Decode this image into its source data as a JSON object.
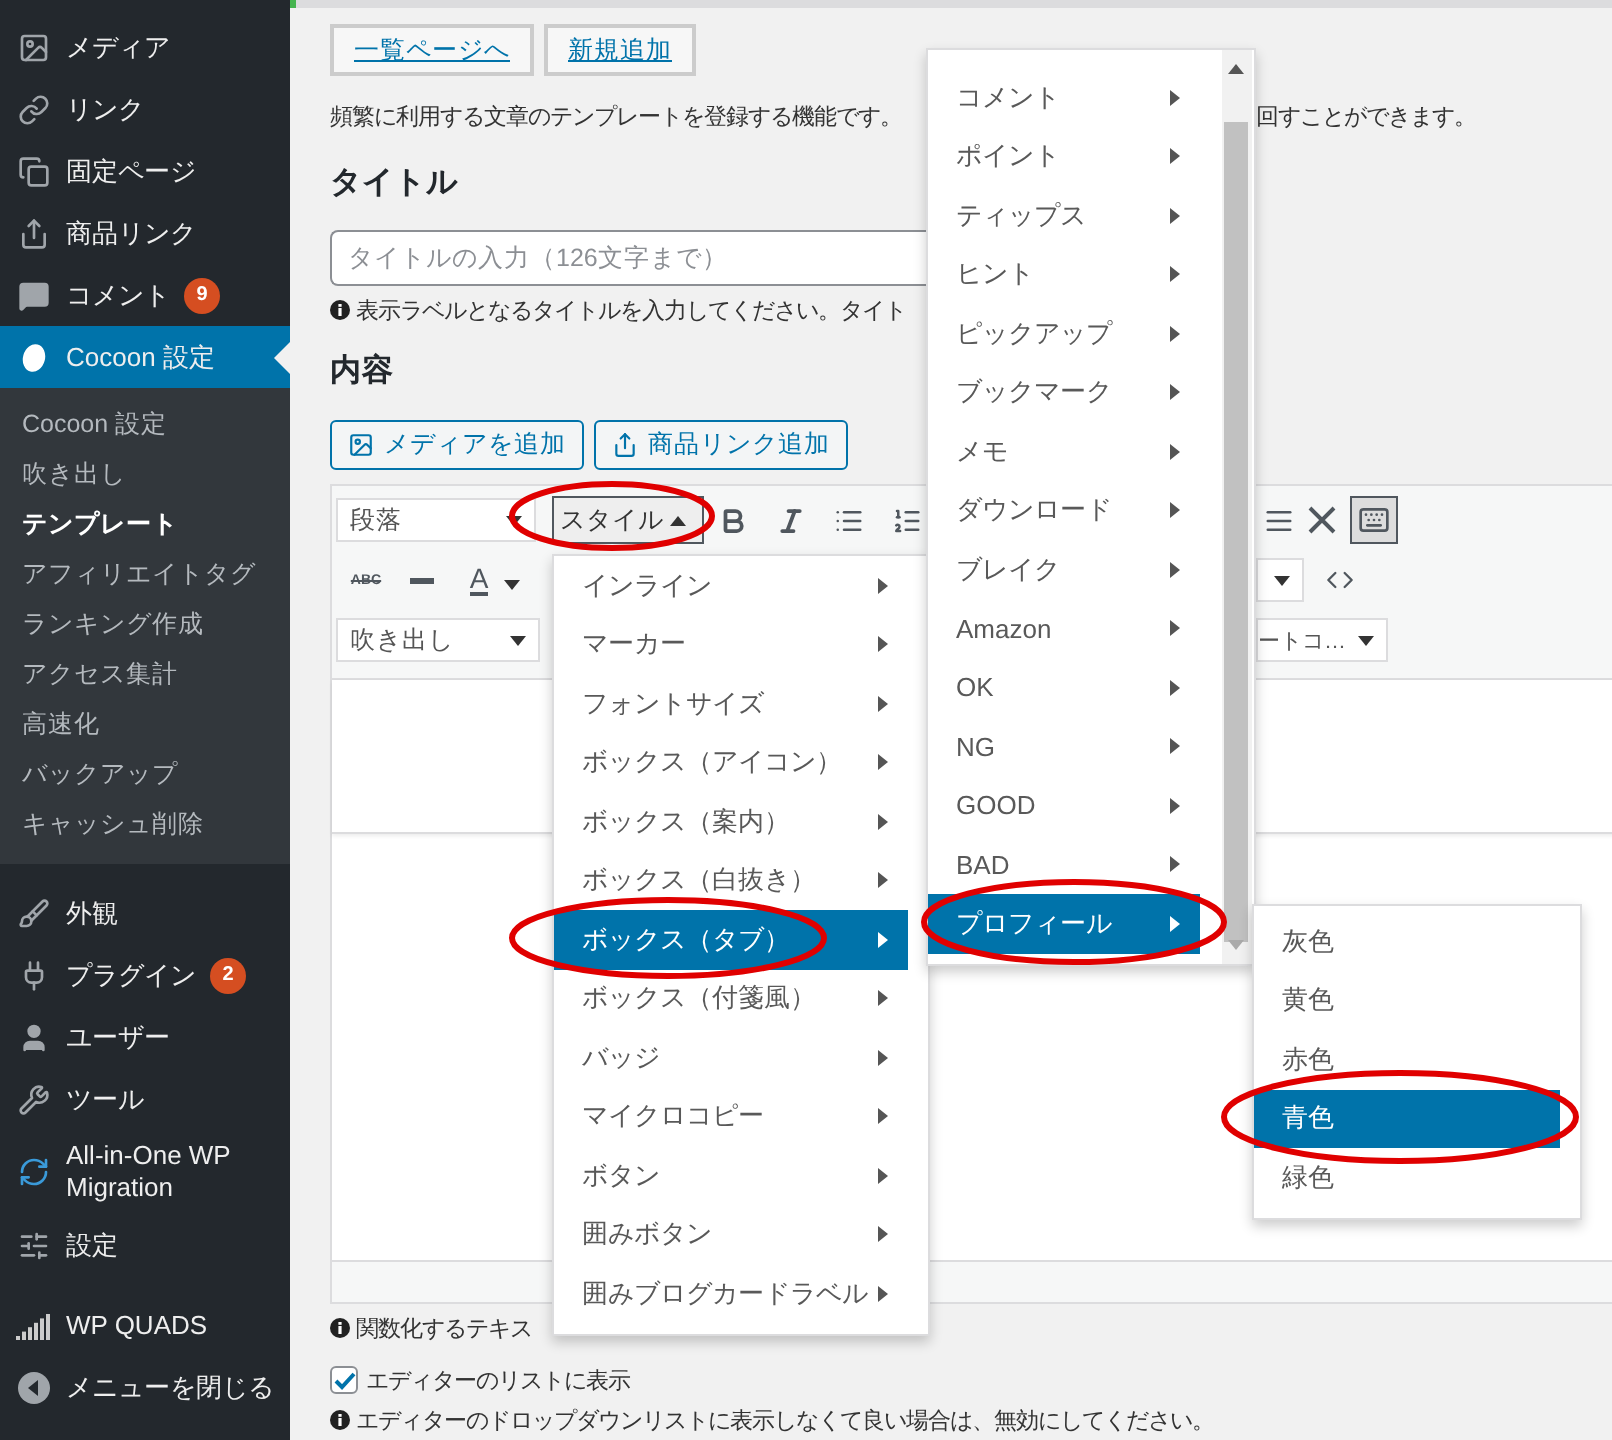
{
  "sidebar": {
    "groups": [
      {
        "items": [
          {
            "label": "メディア",
            "selected": false
          },
          {
            "label": "リンク",
            "selected": false
          },
          {
            "label": "固定ページ",
            "selected": false
          },
          {
            "label": "商品リンク",
            "selected": false
          },
          {
            "label": "コメント",
            "badge": "9",
            "selected": false
          },
          {
            "label": "Cocoon 設定",
            "selected": true,
            "children": [
              {
                "label": "Cocoon 設定",
                "selected": false
              },
              {
                "label": "吹き出し",
                "selected": false
              },
              {
                "label": "テンプレート",
                "selected": true
              },
              {
                "label": "アフィリエイトタグ",
                "selected": false
              },
              {
                "label": "ランキング作成",
                "selected": false
              },
              {
                "label": "アクセス集計",
                "selected": false
              },
              {
                "label": "高速化",
                "selected": false
              },
              {
                "label": "バックアップ",
                "selected": false
              },
              {
                "label": "キャッシュ削除",
                "selected": false
              }
            ]
          }
        ]
      },
      {
        "items": [
          {
            "label": "外観",
            "selected": false
          },
          {
            "label": "プラグイン",
            "badge": "2",
            "selected": false
          },
          {
            "label": "ユーザー",
            "selected": false
          },
          {
            "label": "ツール",
            "selected": false
          },
          {
            "label": "All-in-One WP Migration",
            "selected": false
          },
          {
            "label": "設定",
            "selected": false
          }
        ]
      },
      {
        "items": [
          {
            "label": "WP QUADS",
            "selected": false
          },
          {
            "label": "メニューを閉じる",
            "selected": false
          }
        ]
      }
    ]
  },
  "page": {
    "buttons": [
      "一覧ページへ",
      "新規追加"
    ],
    "description": [
      "頻繁に利用する文章のテンプレートを登録する機能です。",
      "回すことができます。"
    ],
    "title_heading": "タイトル",
    "title_placeholder": "タイトルの入力（126文字まで）",
    "title_hint": "表示ラベルとなるタイトルを入力してください。タイト",
    "content_heading": "内容",
    "media_buttons": [
      "メディアを追加",
      "商品リンク追加"
    ],
    "editor": {
      "format_select": "段落",
      "style_button": {
        "label": "スタイル",
        "expanded": true,
        "circled": true
      },
      "strike_label": "ABC",
      "color_label": "A",
      "balloon_select": "吹き出し",
      "shortcode_select": "ートコ…",
      "toolbar_toggle_on": true
    },
    "function_hint": "関数化するテキス",
    "show_in_editor": {
      "label": "エディターのリストに表示",
      "checked": true
    },
    "dropdown_hint": "エディターのドロップダウンリストに表示しなくて良い場合は、無効にしてください。"
  },
  "style_menu": {
    "arrows": true,
    "items": [
      {
        "label": "インライン",
        "selected": false,
        "circled": false
      },
      {
        "label": "マーカー",
        "selected": false,
        "circled": false
      },
      {
        "label": "フォントサイズ",
        "selected": false,
        "circled": false
      },
      {
        "label": "ボックス（アイコン）",
        "selected": false,
        "circled": false
      },
      {
        "label": "ボックス（案内）",
        "selected": false,
        "circled": false
      },
      {
        "label": "ボックス（白抜き）",
        "selected": false,
        "circled": false
      },
      {
        "label": "ボックス（タブ）",
        "selected": true,
        "circled": true
      },
      {
        "label": "ボックス（付箋風）",
        "selected": false,
        "circled": false
      },
      {
        "label": "バッジ",
        "selected": false,
        "circled": false
      },
      {
        "label": "マイクロコピー",
        "selected": false,
        "circled": false
      },
      {
        "label": "ボタン",
        "selected": false,
        "circled": false
      },
      {
        "label": "囲みボタン",
        "selected": false,
        "circled": false
      },
      {
        "label": "囲みブログカードラベル",
        "selected": false,
        "circled": false
      }
    ]
  },
  "sub_menu": {
    "arrows": true,
    "items": [
      {
        "label": "コメント",
        "selected": false,
        "circled": false
      },
      {
        "label": "ポイント",
        "selected": false,
        "circled": false
      },
      {
        "label": "ティップス",
        "selected": false,
        "circled": false
      },
      {
        "label": "ヒント",
        "selected": false,
        "circled": false
      },
      {
        "label": "ピックアップ",
        "selected": false,
        "circled": false
      },
      {
        "label": "ブックマーク",
        "selected": false,
        "circled": false
      },
      {
        "label": "メモ",
        "selected": false,
        "circled": false
      },
      {
        "label": "ダウンロード",
        "selected": false,
        "circled": false
      },
      {
        "label": "ブレイク",
        "selected": false,
        "circled": false
      },
      {
        "label": "Amazon",
        "selected": false,
        "circled": false
      },
      {
        "label": "OK",
        "selected": false,
        "circled": false
      },
      {
        "label": "NG",
        "selected": false,
        "circled": false
      },
      {
        "label": "GOOD",
        "selected": false,
        "circled": false
      },
      {
        "label": "BAD",
        "selected": false,
        "circled": false
      },
      {
        "label": "プロフィール",
        "selected": true,
        "circled": true
      }
    ]
  },
  "color_menu": {
    "arrows": false,
    "items": [
      {
        "label": "灰色",
        "selected": false,
        "circled": false
      },
      {
        "label": "黄色",
        "selected": false,
        "circled": false
      },
      {
        "label": "赤色",
        "selected": false,
        "circled": false
      },
      {
        "label": "青色",
        "selected": true,
        "circled": true
      },
      {
        "label": "緑色",
        "selected": false,
        "circled": false
      }
    ]
  }
}
